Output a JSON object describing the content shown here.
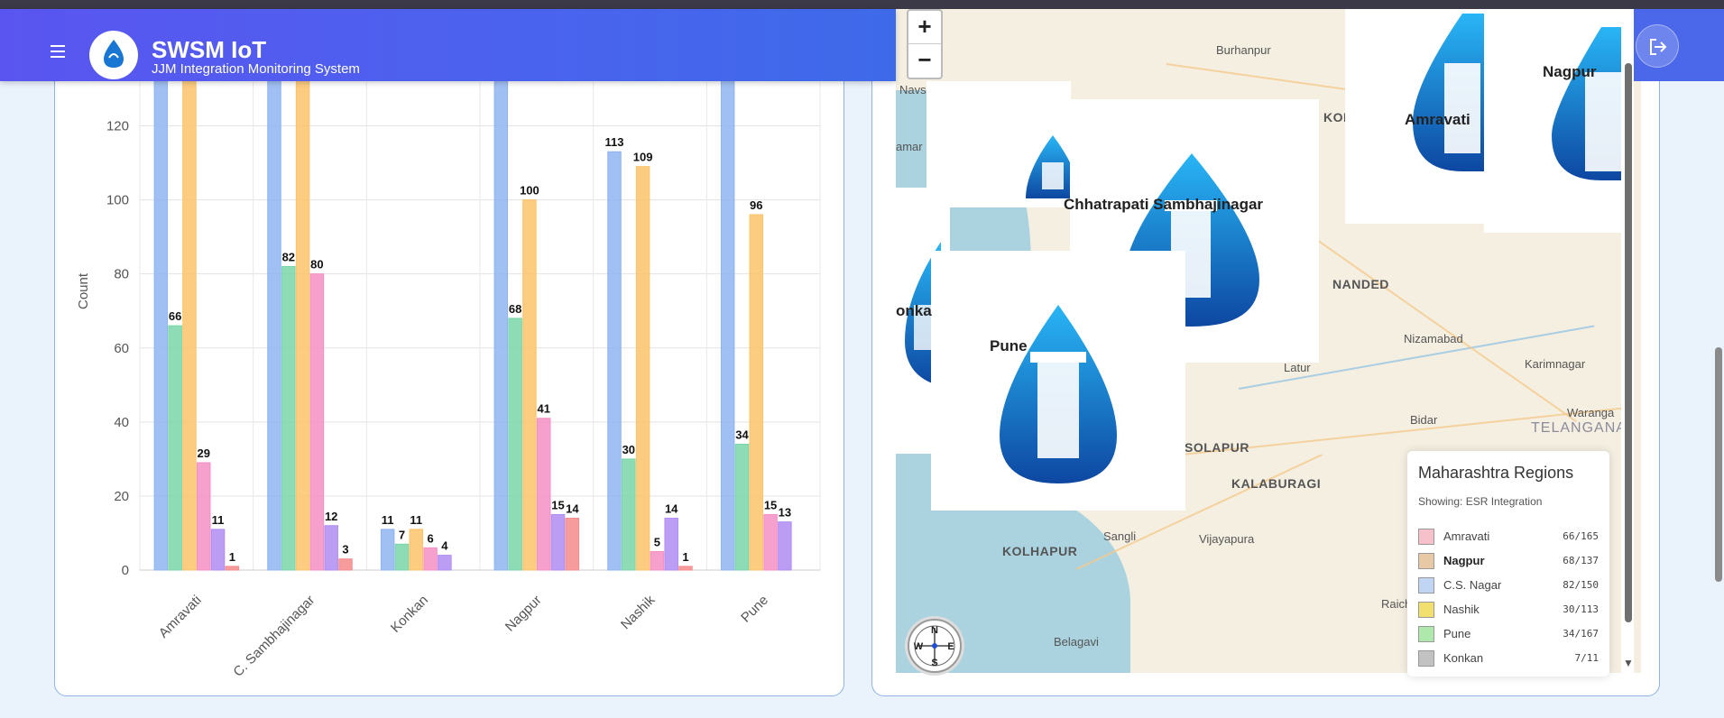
{
  "header": {
    "title": "SWSM IoT",
    "subtitle": "JJM Integration Monitoring System"
  },
  "chart_data": {
    "type": "bar",
    "categories": [
      "Amravati",
      "C. Sambhajinagar",
      "Konkan",
      "Nagpur",
      "Nashik",
      "Pune"
    ],
    "ylabel": "Count",
    "ylim": [
      0,
      120
    ],
    "yticks": [
      0,
      20,
      40,
      60,
      80,
      100,
      120
    ],
    "grid": true,
    "series": [
      {
        "color": "#8fb4f0",
        "values": [
          135,
          135,
          11,
          135,
          113,
          135
        ],
        "labels": [
          "",
          "",
          "11",
          "",
          "113",
          ""
        ]
      },
      {
        "color": "#79d6a8",
        "values": [
          66,
          82,
          7,
          68,
          30,
          34
        ],
        "labels": [
          "66",
          "82",
          "7",
          "68",
          "30",
          "34"
        ]
      },
      {
        "color": "#fbc36a",
        "values": [
          135,
          135,
          11,
          100,
          109,
          96
        ],
        "labels": [
          "",
          "",
          "11",
          "100",
          "109",
          "96"
        ]
      },
      {
        "color": "#f48fc4",
        "values": [
          29,
          80,
          6,
          41,
          5,
          15
        ],
        "labels": [
          "29",
          "80",
          "6",
          "41",
          "5",
          "15"
        ]
      },
      {
        "color": "#b08cf2",
        "values": [
          11,
          12,
          4,
          15,
          14,
          13
        ],
        "labels": [
          "11",
          "12",
          "4",
          "15",
          "14",
          "13"
        ]
      },
      {
        "color": "#f58b8b",
        "values": [
          1,
          3,
          0,
          14,
          1,
          0
        ],
        "labels": [
          "1",
          "3",
          "",
          "14",
          "1",
          ""
        ]
      }
    ]
  },
  "map": {
    "zoom_in": "+",
    "zoom_out": "−",
    "cities": {
      "burhanpur": "Burhanpur",
      "navsari": "Navsa",
      "daman": "amar",
      "kol": "KOL",
      "nanded": "NANDED",
      "nizamabad": "Nizamabad",
      "karimnagar": "Karimnagar",
      "latur": "Latur",
      "bidar": "Bidar",
      "warangal": "Waranga",
      "telangana": "TELANGANA",
      "solapur": "SOLAPUR",
      "kalaburagi": "KALABURAGI",
      "kolhapur": "KOLHAPUR",
      "sangli": "Sangli",
      "vijayapura": "Vijayapura",
      "raichur": "Raichur",
      "belagavi": "Belagavi"
    },
    "region_labels": {
      "amravati": "Amravati",
      "nagpur": "Nagpur",
      "sambhajinagar": "Chhatrapati Sambhajinagar",
      "konkan": "onka",
      "pune": "Pune"
    },
    "compass": {
      "n": "N",
      "s": "S",
      "e": "E",
      "w": "W"
    },
    "legend": {
      "title": "Maharashtra Regions",
      "subtitle": "Showing: ESR Integration",
      "items": [
        {
          "name": "Amravati",
          "count": "66/165",
          "color": "#f6c1cb"
        },
        {
          "name": "Nagpur",
          "count": "68/137",
          "color": "#e8c9a6"
        },
        {
          "name": "C.S. Nagar",
          "count": "82/150",
          "color": "#c0d4f4"
        },
        {
          "name": "Nashik",
          "count": "30/113",
          "color": "#f1df6e"
        },
        {
          "name": "Pune",
          "count": "34/167",
          "color": "#aee8aa"
        },
        {
          "name": "Konkan",
          "count": "7/11",
          "color": "#c2c2c2"
        }
      ]
    },
    "scroll_down": "▼"
  }
}
